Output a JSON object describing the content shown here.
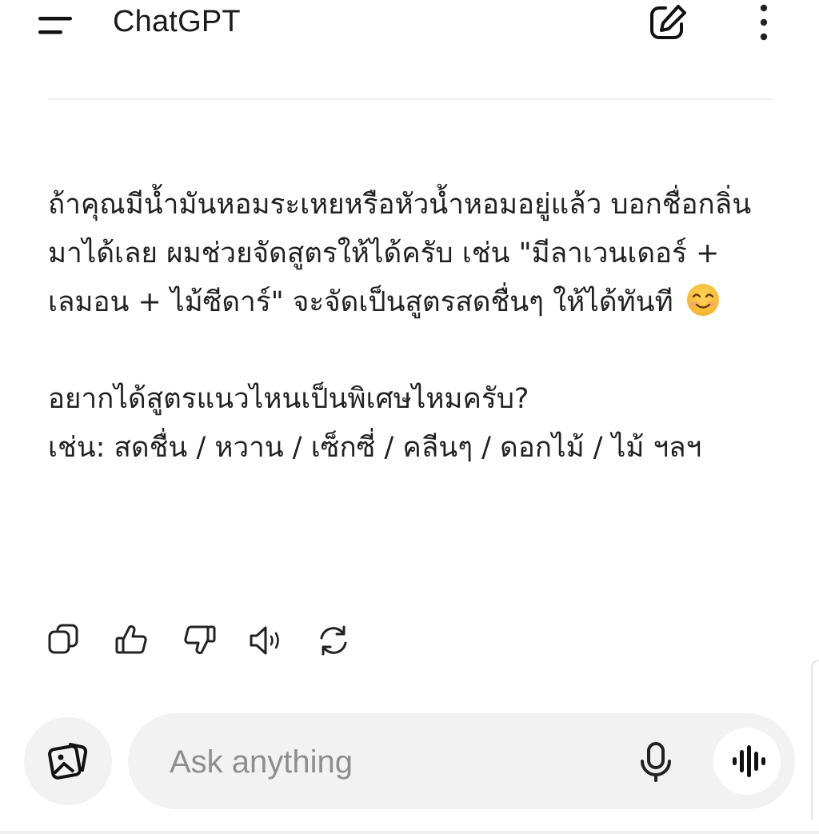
{
  "header": {
    "title": "ChatGPT",
    "menu_icon": "menu-icon",
    "compose_icon": "new-chat-edit-icon",
    "more_icon": "more-vertical-icon"
  },
  "message": {
    "paragraph1": "ถ้าคุณมีน้ำมันหอมระเหยหรือหัวน้ำหอมอยู่แล้ว บอกชื่อกลิ่นมาได้เลย ผมช่วยจัดสูตรให้ได้ครับ เช่น \"มีลาเวนเดอร์ + เลมอน + ไม้ซีดาร์\" จะจัดเป็นสูตรสดชื่นๆ ให้ได้ทันที",
    "paragraph1_emoji": "smiling-face-emoji",
    "question": "อยากได้สูตรแนวไหนเป็นพิเศษไหมครับ?",
    "examples": "เช่น: สดชื่น / หวาน / เซ็กซี่ / คลีนๆ / ดอกไม้ / ไม้ ฯลฯ"
  },
  "message_actions": [
    {
      "icon": "copy-icon"
    },
    {
      "icon": "thumbs-up-icon"
    },
    {
      "icon": "thumbs-down-icon"
    },
    {
      "icon": "read-aloud-icon"
    },
    {
      "icon": "regenerate-icon"
    }
  ],
  "composer": {
    "placeholder": "Ask anything",
    "value": "",
    "left_button_icon": "image-library-icon",
    "mic_icon": "microphone-icon",
    "voice_icon": "voice-mode-waveform-icon"
  },
  "colors": {
    "background": "#ffffff",
    "text": "#222222",
    "composer_bg": "#f2f2f2",
    "placeholder": "#8e8e8e",
    "divider": "#ececec"
  }
}
